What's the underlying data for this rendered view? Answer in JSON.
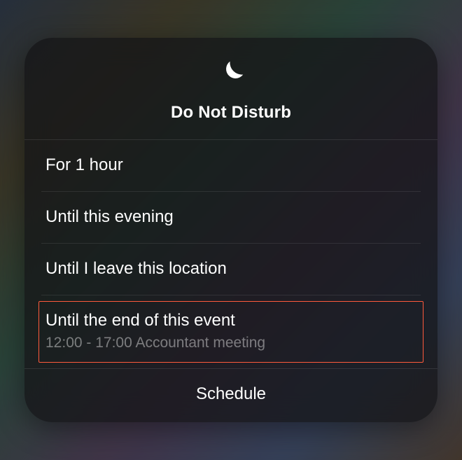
{
  "title": "Do Not Disturb",
  "options": [
    {
      "label": "For 1 hour"
    },
    {
      "label": "Until this evening"
    },
    {
      "label": "Until I leave this location"
    },
    {
      "label": "Until the end of this event",
      "subtitle": "12:00 - 17:00 Accountant meeting"
    }
  ],
  "schedule_label": "Schedule"
}
